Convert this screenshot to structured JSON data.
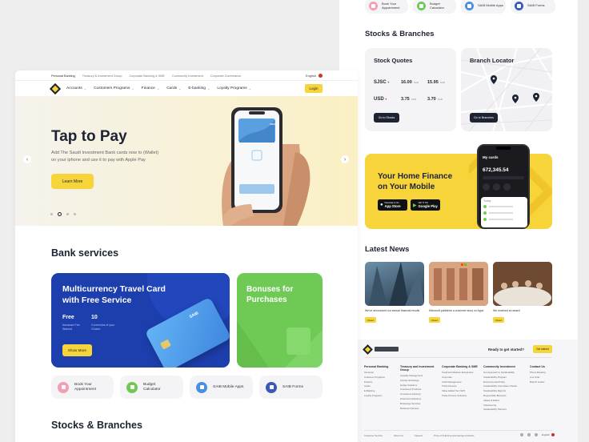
{
  "colors": {
    "accent": "#f7d43a",
    "dark": "#1d2333",
    "blue": "#1d3fae",
    "green": "#6fca55"
  },
  "quick_links": [
    {
      "label": "Book Your Appointment",
      "icon": "calendar-icon",
      "color": "#f29fb3"
    },
    {
      "label": "Budget Calculator",
      "icon": "calculator-icon",
      "color": "#6fca55"
    },
    {
      "label": "SAIB Mobile Apps",
      "icon": "mobile-icon",
      "color": "#4a90e2"
    },
    {
      "label": "SAIB Forms",
      "icon": "form-icon",
      "color": "#3b5ab6"
    }
  ],
  "right": {
    "stocks_heading": "Stocks & Branches",
    "stock_quotes": {
      "title": "Stock Quotes",
      "rows": [
        {
          "symbol": "SJSC",
          "arrow": "▾",
          "v1": "16.00",
          "s1": "SAR",
          "v2": "15.95",
          "s2": "SAR"
        },
        {
          "symbol": "USD",
          "arrow": "▾",
          "v1": "3.75",
          "s1": "SAR",
          "v2": "3.70",
          "s2": "SAR"
        }
      ],
      "button": "Go to Stocks"
    },
    "branch_locator": {
      "title": "Branch Locator",
      "button": "Go to Branches"
    },
    "promo": {
      "line1": "Your Home Finance",
      "line2": "on Your Mobile",
      "app_store": "App Store",
      "app_store_pre": "Download on the",
      "google_play": "Google Play",
      "google_play_pre": "GET IT ON",
      "phone_title": "My cards",
      "phone_amount": "672,345.54",
      "phone_today": "Today"
    },
    "news_heading": "Latest News",
    "news": [
      {
        "caption": "We've announced our annual financial results",
        "button": "Read"
      },
      {
        "caption": "Microsoft publishes a customer story on Apps",
        "button": "Read"
      },
      {
        "caption": "We received an award",
        "button": "Read"
      }
    ],
    "footer": {
      "cta": "Ready to get started?",
      "cta_button": "Get started",
      "columns": [
        {
          "heading": "Personal Banking",
          "items": [
            "Accounts",
            "Customer Programs",
            "Finance",
            "Cards",
            "E-Banking",
            "Loyalty Programs"
          ]
        },
        {
          "heading": "Treasury and Investment Group",
          "items": [
            "Liquidity Management",
            "Foreign Exchange",
            "Hedge Solutions",
            "Investment Products",
            "Investment Advisory",
            "Financial Institutions",
            "Brokerage Services",
            "Business Partners"
          ]
        },
        {
          "heading": "Corporate Banking & SME",
          "items": [
            "Small and Medium Enterprises",
            "Corporate",
            "Cash Management",
            "Trade Finance",
            "Value Added Tax (VAT)",
            "Trade Finance Solutions"
          ]
        },
        {
          "heading": "Community Investment",
          "items": [
            "Our Approach to Sustainability",
            "Sustainability Program",
            "Environmental Policy",
            "Sustainability Committee Charter",
            "Sustainability Reports",
            "Responsible Business",
            "Values & Ethics",
            "Volunteering",
            "Sustainability Partners"
          ]
        },
        {
          "heading": "Contact Us",
          "items": [
            "Phone Banking",
            "Live Chat",
            "Branch locator"
          ]
        }
      ],
      "bottom_links": [
        "Customer Service",
        "About Us",
        "Careers",
        "Price of financing and savings products"
      ],
      "lang": "English"
    }
  },
  "left": {
    "top_links": [
      "Personal Banking",
      "Treasury & Investment Group",
      "Corporate Banking & SME",
      "Community Investment",
      "Corporate Governance"
    ],
    "language": "English",
    "nav": [
      "Accounts",
      "Customers Programs",
      "Finance",
      "Cards",
      "E-banking",
      "Loyalty Programs"
    ],
    "login": "Login",
    "hero": {
      "title": "Tap to Pay",
      "desc1": "Add The Saudi Investment Bank cards now to (Wallet)",
      "desc2": "on your iphone and use it to pay with Apple Pay",
      "button": "Learn More",
      "card_brand": "VISA",
      "prev": "‹",
      "next": "›"
    },
    "services_heading": "Bank services",
    "travel_card": {
      "line1": "Multicurrency Travel Card",
      "line2": "with Free Service",
      "stat1_value": "Free",
      "stat1_label": "Issuance Fee Waived",
      "stat2_value": "10",
      "stat2_label": "Currencies of your Choice",
      "button": "Show More",
      "card_text": "SAIB"
    },
    "bonuses": {
      "line1": "Bonuses for",
      "line2": "Purchases"
    },
    "stocks_heading": "Stocks & Branches"
  }
}
